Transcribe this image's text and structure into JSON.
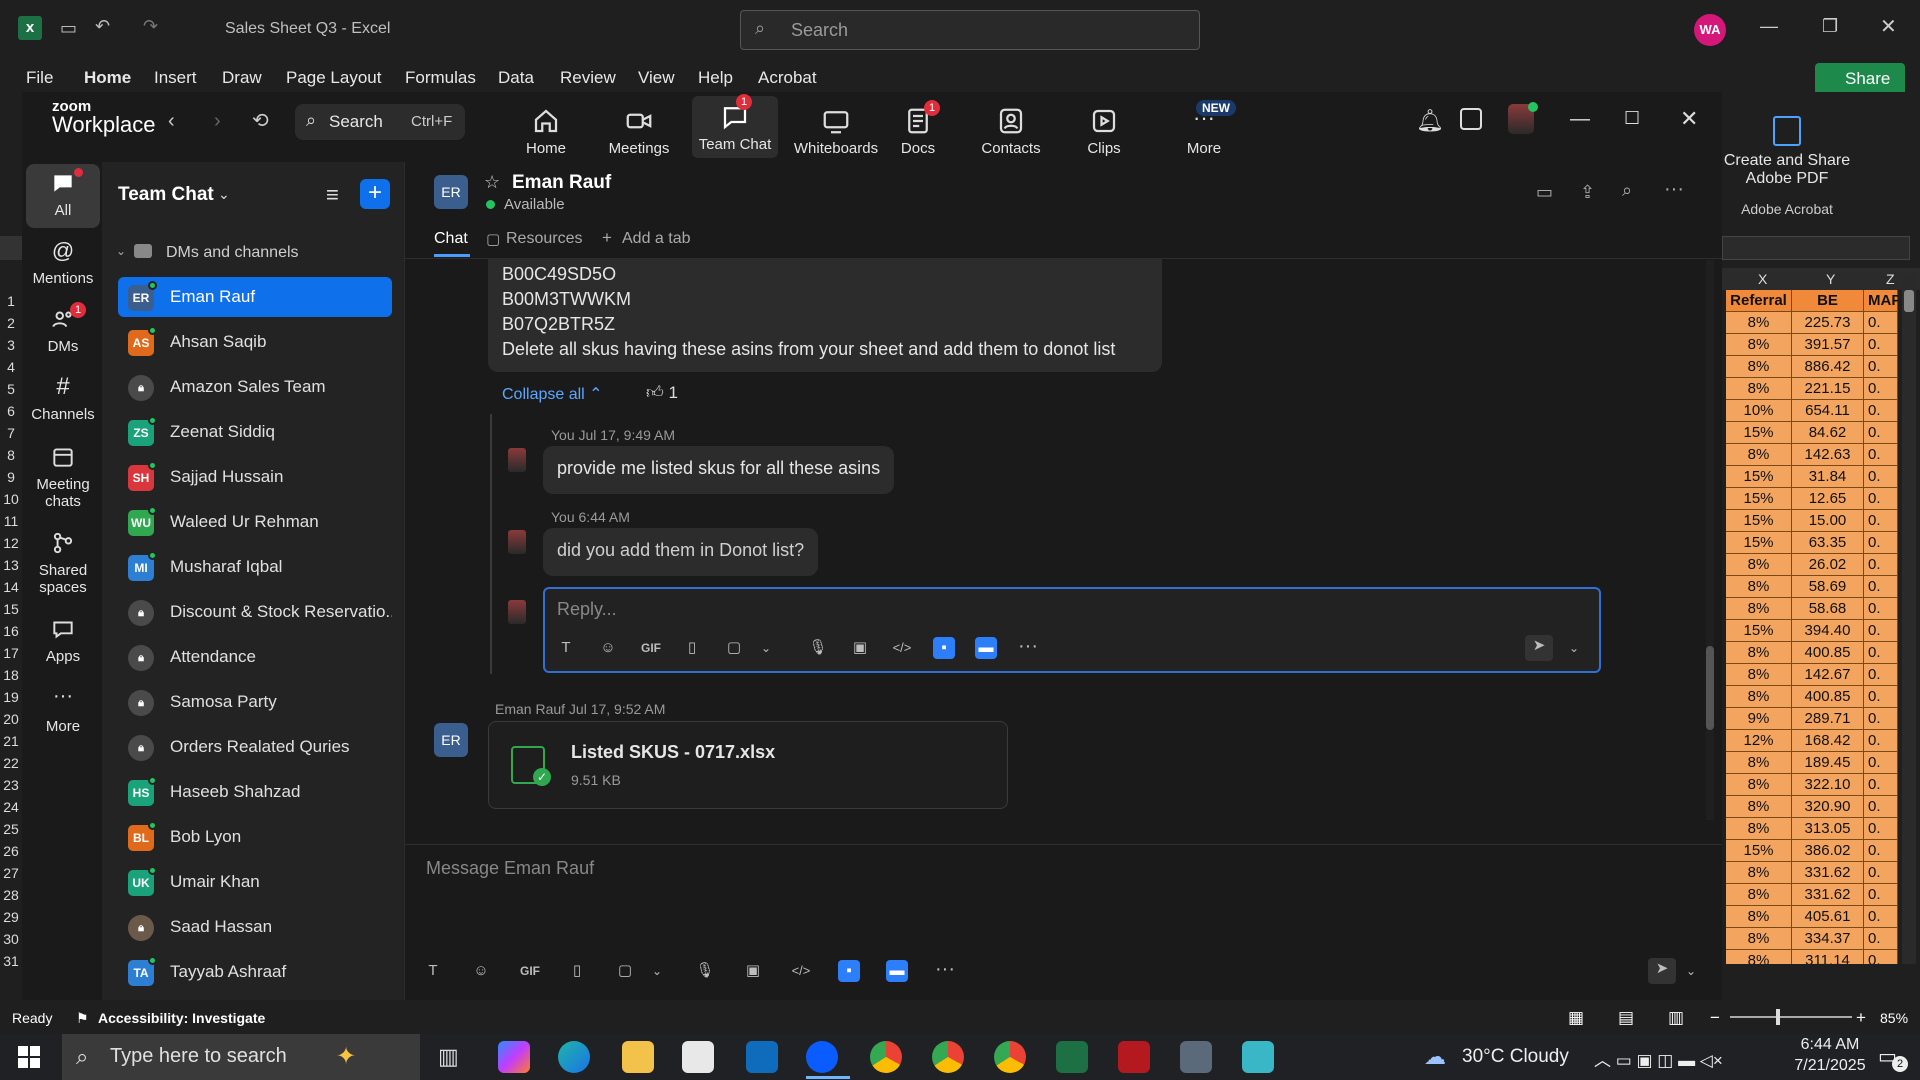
{
  "excel": {
    "doc_title": "Sales Sheet Q3 - Excel",
    "search_placeholder": "Search",
    "avatar": "WA",
    "share": "Share",
    "tabs": [
      "File",
      "Home",
      "Insert",
      "Draw",
      "Page Layout",
      "Formulas",
      "Data",
      "Review",
      "View",
      "Help",
      "Acrobat"
    ],
    "acrobat_btn": "Create and Share Adobe PDF",
    "acrobat_group": "Adobe Acrobat",
    "columns": [
      "X",
      "Y",
      "Z"
    ],
    "header_row": [
      "Referral",
      "BE",
      "MAP"
    ],
    "rows": [
      [
        "8%",
        "225.73",
        "0."
      ],
      [
        "8%",
        "391.57",
        "0."
      ],
      [
        "8%",
        "886.42",
        "0."
      ],
      [
        "8%",
        "221.15",
        "0."
      ],
      [
        "10%",
        "654.11",
        "0."
      ],
      [
        "15%",
        "84.62",
        "0."
      ],
      [
        "8%",
        "142.63",
        "0."
      ],
      [
        "15%",
        "31.84",
        "0."
      ],
      [
        "15%",
        "12.65",
        "0."
      ],
      [
        "15%",
        "15.00",
        "0."
      ],
      [
        "15%",
        "63.35",
        "0."
      ],
      [
        "8%",
        "26.02",
        "0."
      ],
      [
        "8%",
        "58.69",
        "0."
      ],
      [
        "8%",
        "58.68",
        "0."
      ],
      [
        "15%",
        "394.40",
        "0."
      ],
      [
        "8%",
        "400.85",
        "0."
      ],
      [
        "8%",
        "142.67",
        "0."
      ],
      [
        "8%",
        "400.85",
        "0."
      ],
      [
        "9%",
        "289.71",
        "0."
      ],
      [
        "12%",
        "168.42",
        "0."
      ],
      [
        "8%",
        "189.45",
        "0."
      ],
      [
        "8%",
        "322.10",
        "0."
      ],
      [
        "8%",
        "320.90",
        "0."
      ],
      [
        "8%",
        "313.05",
        "0."
      ],
      [
        "15%",
        "386.02",
        "0."
      ],
      [
        "8%",
        "331.62",
        "0."
      ],
      [
        "8%",
        "331.62",
        "0."
      ],
      [
        "8%",
        "405.61",
        "0."
      ],
      [
        "8%",
        "334.37",
        "0."
      ],
      [
        "8%",
        "311.14",
        "0."
      ]
    ],
    "row_numbers": [
      "1",
      "2",
      "3",
      "4",
      "5",
      "6",
      "7",
      "8",
      "9",
      "10",
      "11",
      "12",
      "13",
      "14",
      "15",
      "16",
      "17",
      "18",
      "19",
      "20",
      "21",
      "22",
      "23",
      "24",
      "25",
      "26",
      "27",
      "28",
      "29",
      "30",
      "31"
    ],
    "status_ready": "Ready",
    "status_accessibility": "Accessibility: Investigate",
    "zoom_level": "85%"
  },
  "zoom": {
    "brand_top": "zoom",
    "brand_bottom": "Workplace",
    "search_label": "Search",
    "search_shortcut": "Ctrl+F",
    "nav": [
      {
        "label": "Home"
      },
      {
        "label": "Meetings"
      },
      {
        "label": "Team Chat",
        "badge": "1"
      },
      {
        "label": "Whiteboards"
      },
      {
        "label": "Docs",
        "badge": "1"
      },
      {
        "label": "Contacts"
      },
      {
        "label": "Clips"
      },
      {
        "label": "More",
        "badge": "NEW"
      }
    ],
    "rail": [
      {
        "label": "All"
      },
      {
        "label": "Mentions"
      },
      {
        "label": "DMs",
        "badge": "1"
      },
      {
        "label": "Channels"
      },
      {
        "label": "Meeting chats"
      },
      {
        "label": "Shared spaces"
      },
      {
        "label": "Apps"
      },
      {
        "label": "More"
      }
    ],
    "list_title": "Team Chat",
    "section": "DMs and channels",
    "contacts": [
      {
        "name": "Eman Rauf",
        "initials": "ER",
        "color": "#3a5f8f"
      },
      {
        "name": "Ahsan Saqib",
        "initials": "AS",
        "color": "#e06a1b"
      },
      {
        "name": "Amazon Sales Team",
        "initials": "",
        "color": "#4a4a4a"
      },
      {
        "name": "Zeenat Siddiq",
        "initials": "ZS",
        "color": "#1aa37a"
      },
      {
        "name": "Sajjad Hussain",
        "initials": "SH",
        "color": "#d9363e"
      },
      {
        "name": "Waleed Ur Rehman",
        "initials": "WU",
        "color": "#2fa84f"
      },
      {
        "name": "Musharaf Iqbal",
        "initials": "MI",
        "color": "#2d7fd3"
      },
      {
        "name": "Discount & Stock Reservatio...",
        "initials": "",
        "color": "#4a4a4a"
      },
      {
        "name": "Attendance",
        "initials": "",
        "color": "#4a4a4a"
      },
      {
        "name": "Samosa Party",
        "initials": "",
        "color": "#4a4a4a"
      },
      {
        "name": "Orders Realated Quries",
        "initials": "",
        "color": "#4a4a4a"
      },
      {
        "name": "Haseeb Shahzad",
        "initials": "HS",
        "color": "#1aa37a"
      },
      {
        "name": "Bob Lyon",
        "initials": "BL",
        "color": "#e06a1b"
      },
      {
        "name": "Umair Khan",
        "initials": "UK",
        "color": "#1aa37a"
      },
      {
        "name": "Saad Hassan",
        "initials": "",
        "color": "#6b5a4a"
      },
      {
        "name": "Tayyab Ashraaf",
        "initials": "TA",
        "color": "#2d7fd3"
      }
    ],
    "chat": {
      "name": "Eman Rauf",
      "initials": "ER",
      "status": "Available",
      "tabs": [
        "Chat",
        "Resources",
        "Add a tab"
      ],
      "asin_lines": [
        "B00C49SD5O",
        "B00M3TWWKM",
        "B07Q2BTR5Z",
        "Delete all skus having these asins from your sheet and add them to donot list"
      ],
      "collapse_all": "Collapse all",
      "reaction_count": "1",
      "msg1_meta": "You Jul 17, 9:49 AM",
      "msg1_text": "provide me listed skus for all these asins",
      "msg2_meta": "You 6:44 AM",
      "msg2_text": "did you add them in Donot list?",
      "reply_placeholder": "Reply...",
      "file_meta": "Eman Rauf Jul 17, 9:52 AM",
      "file_name": "Listed SKUS - 0717.xlsx",
      "file_size": "9.51 KB",
      "composer_placeholder": "Message Eman Rauf",
      "gif": "GIF"
    }
  },
  "taskbar": {
    "search_placeholder": "Type here to search",
    "weather": "30°C  Cloudy",
    "time": "6:44 AM",
    "date": "7/21/2025",
    "notif": "2"
  }
}
